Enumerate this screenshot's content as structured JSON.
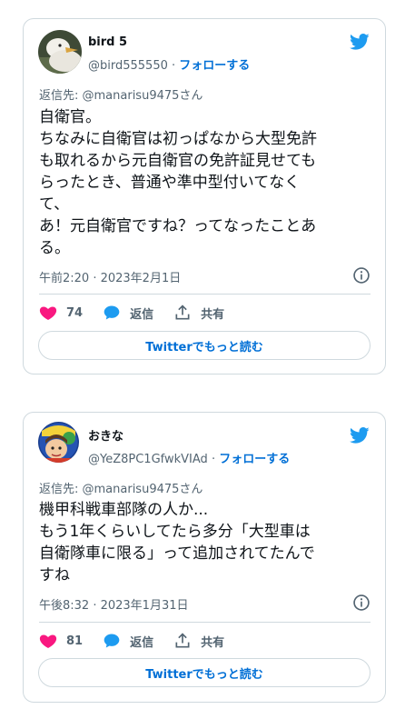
{
  "tweets": [
    {
      "name": "bird 5",
      "handle": "@bird555550",
      "separator": "·",
      "follow": "フォローする",
      "reply_to": "返信先: @manarisu9475さん",
      "text": "自衛官。\nちなみに自衛官は初っぱなから大型免許\nも取れるから元自衛官の免許証見せても\nらったとき、普通や準中型付いてなく\nて、\nあ！元自衛官ですね？ってなったことあ\nる。",
      "timestamp": "午前2:20 · 2023年2月1日",
      "likes": "74",
      "reply_label": "返信",
      "share_label": "共有",
      "more_label": "Twitterでもっと読む"
    },
    {
      "name": "おきな",
      "handle": "@YeZ8PC1GfwkVIAd",
      "separator": "·",
      "follow": "フォローする",
      "reply_to": "返信先: @manarisu9475さん",
      "text": "機甲科戦車部隊の人か...\nもう1年くらいしてたら多分「大型車は\n自衛隊車に限る」って追加されてたんで\nすね",
      "timestamp": "午後8:32 · 2023年1月31日",
      "likes": "81",
      "reply_label": "返信",
      "share_label": "共有",
      "more_label": "Twitterでもっと読む"
    }
  ],
  "icons": {
    "brand": "twitter-bird-icon",
    "like": "heart-icon",
    "reply": "speech-bubble-icon",
    "share": "share-icon",
    "info": "info-icon"
  },
  "colors": {
    "brand": "#1d9bf0",
    "like": "#f91880",
    "link": "#006fd6",
    "border": "#cfd9de",
    "muted": "#536471"
  }
}
